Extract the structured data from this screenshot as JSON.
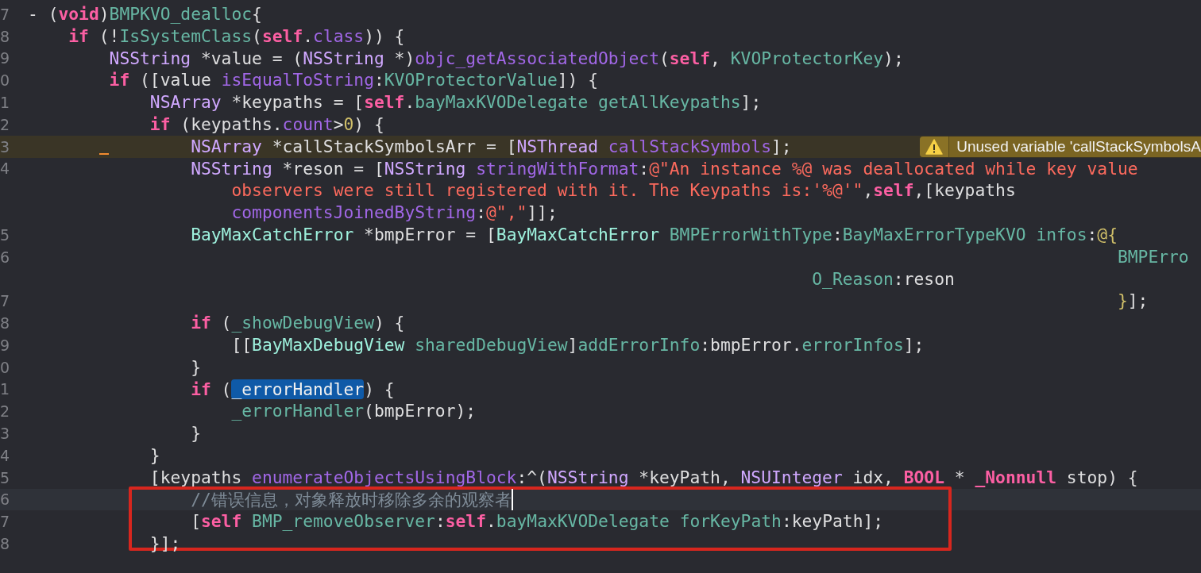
{
  "editor": {
    "lines": [
      {
        "number": "7",
        "tokens": [
          {
            "kind": "pl",
            "text": "- ("
          },
          {
            "kind": "kw",
            "text": "void"
          },
          {
            "kind": "pl",
            "text": ")"
          },
          {
            "kind": "pm",
            "text": "BMPKVO_dealloc"
          },
          {
            "kind": "pl",
            "text": "{"
          }
        ]
      },
      {
        "number": "8",
        "tokens": [
          {
            "kind": "kw",
            "text": "    if"
          },
          {
            "kind": "pl",
            "text": " (!"
          },
          {
            "kind": "pm",
            "text": "IsSystemClass"
          },
          {
            "kind": "pl",
            "text": "("
          },
          {
            "kind": "kw",
            "text": "self"
          },
          {
            "kind": "pl",
            "text": "."
          },
          {
            "kind": "fn",
            "text": "class"
          },
          {
            "kind": "pl",
            "text": ")) {"
          }
        ]
      },
      {
        "number": "9",
        "tokens": [
          {
            "kind": "ty",
            "text": "        NSString"
          },
          {
            "kind": "pl",
            "text": " *value = ("
          },
          {
            "kind": "ty",
            "text": "NSString"
          },
          {
            "kind": "pl",
            "text": " *)"
          },
          {
            "kind": "fn",
            "text": "objc_getAssociatedObject"
          },
          {
            "kind": "pl",
            "text": "("
          },
          {
            "kind": "kw",
            "text": "self"
          },
          {
            "kind": "pl",
            "text": ", "
          },
          {
            "kind": "pm",
            "text": "KVOProtectorKey"
          },
          {
            "kind": "pl",
            "text": ");"
          }
        ]
      },
      {
        "number": "0",
        "tokens": [
          {
            "kind": "kw",
            "text": "        if"
          },
          {
            "kind": "pl",
            "text": " ([value "
          },
          {
            "kind": "fn",
            "text": "isEqualToString"
          },
          {
            "kind": "pl",
            "text": ":"
          },
          {
            "kind": "pm",
            "text": "KVOProtectorValue"
          },
          {
            "kind": "pl",
            "text": "]) {"
          }
        ]
      },
      {
        "number": "1",
        "tokens": [
          {
            "kind": "ty",
            "text": "            NSArray"
          },
          {
            "kind": "pl",
            "text": " *keypaths = ["
          },
          {
            "kind": "kw",
            "text": "self"
          },
          {
            "kind": "pl",
            "text": "."
          },
          {
            "kind": "pm",
            "text": "bayMaxKVODelegate"
          },
          {
            "kind": "pm",
            "text": " getAllKeypaths"
          },
          {
            "kind": "pl",
            "text": "];"
          }
        ]
      },
      {
        "number": "2",
        "tokens": [
          {
            "kind": "kw",
            "text": "            if"
          },
          {
            "kind": "pl",
            "text": " (keypaths."
          },
          {
            "kind": "fn",
            "text": "count"
          },
          {
            "kind": "pl",
            "text": ">"
          },
          {
            "kind": "nu",
            "text": "0"
          },
          {
            "kind": "pl",
            "text": ") {"
          }
        ]
      },
      {
        "number": "3",
        "warning": "Unused variable 'callStackSymbolsA",
        "tokens": [
          {
            "kind": "ty",
            "text": "                NSArray"
          },
          {
            "kind": "pl",
            "text": " *callStackSymbolsArr = ["
          },
          {
            "kind": "ty",
            "text": "NSThread"
          },
          {
            "kind": "fn",
            "text": " callStackSymbols"
          },
          {
            "kind": "pl",
            "text": "];"
          }
        ]
      },
      {
        "number": "4",
        "tokens": [
          {
            "kind": "ty",
            "text": "                NSString"
          },
          {
            "kind": "pl",
            "text": " *reson = ["
          },
          {
            "kind": "ty",
            "text": "NSString"
          },
          {
            "kind": "fn",
            "text": " stringWithFormat"
          },
          {
            "kind": "pl",
            "text": ":"
          },
          {
            "kind": "st",
            "text": "@\"An instance %@ was deallocated while key value"
          }
        ]
      },
      {
        "tokens": [
          {
            "kind": "st",
            "text": "                    observers were still registered with it. The Keypaths is:'%@'\""
          },
          {
            "kind": "pl",
            "text": ","
          },
          {
            "kind": "kw",
            "text": "self"
          },
          {
            "kind": "pl",
            "text": ",[keypaths"
          }
        ]
      },
      {
        "tokens": [
          {
            "kind": "fn",
            "text": "                    componentsJoinedByString"
          },
          {
            "kind": "pl",
            "text": ":"
          },
          {
            "kind": "st",
            "text": "@\",\""
          },
          {
            "kind": "pl",
            "text": "]];"
          }
        ]
      },
      {
        "number": "5",
        "tokens": [
          {
            "kind": "pt",
            "text": "                BayMaxCatchError"
          },
          {
            "kind": "pl",
            "text": " *bmpError = ["
          },
          {
            "kind": "pt",
            "text": "BayMaxCatchError"
          },
          {
            "kind": "pm",
            "text": " BMPErrorWithType"
          },
          {
            "kind": "pl",
            "text": ":"
          },
          {
            "kind": "pm",
            "text": "BayMaxErrorTypeKVO"
          },
          {
            "kind": "pm",
            "text": " infos"
          },
          {
            "kind": "pl",
            "text": ":"
          },
          {
            "kind": "nu",
            "text": "@{"
          }
        ]
      },
      {
        "number": "6",
        "tokens": [
          {
            "kind": "pm",
            "text": "                                                                                                           BMPErro"
          }
        ]
      },
      {
        "tokens": [
          {
            "kind": "pm",
            "text": "                                                                             O_Reason"
          },
          {
            "kind": "pl",
            "text": ":reson"
          }
        ]
      },
      {
        "number": "7",
        "tokens": [
          {
            "kind": "nu",
            "text": "                                                                                                           }"
          },
          {
            "kind": "pl",
            "text": "];"
          }
        ]
      },
      {
        "number": "8",
        "tokens": [
          {
            "kind": "kw",
            "text": "                if"
          },
          {
            "kind": "pl",
            "text": " ("
          },
          {
            "kind": "pm",
            "text": "_showDebugView"
          },
          {
            "kind": "pl",
            "text": ") {"
          }
        ]
      },
      {
        "number": "9",
        "tokens": [
          {
            "kind": "pl",
            "text": "                    [["
          },
          {
            "kind": "pt",
            "text": "BayMaxDebugView"
          },
          {
            "kind": "pm",
            "text": " sharedDebugView"
          },
          {
            "kind": "pl",
            "text": "]"
          },
          {
            "kind": "pm",
            "text": "addErrorInfo"
          },
          {
            "kind": "pl",
            "text": ":bmpError."
          },
          {
            "kind": "pm",
            "text": "errorInfos"
          },
          {
            "kind": "pl",
            "text": "];"
          }
        ]
      },
      {
        "number": "0",
        "tokens": [
          {
            "kind": "pl",
            "text": "                }"
          }
        ]
      },
      {
        "number": "1",
        "tokens": [
          {
            "kind": "kw",
            "text": "                if"
          },
          {
            "kind": "pl",
            "text": " ("
          },
          {
            "kind": "sel",
            "text": "_errorHandler"
          },
          {
            "kind": "pl",
            "text": ") {"
          }
        ]
      },
      {
        "number": "2",
        "tokens": [
          {
            "kind": "pm",
            "text": "                    _errorHandler"
          },
          {
            "kind": "pl",
            "text": "(bmpError);"
          }
        ]
      },
      {
        "number": "3",
        "tokens": [
          {
            "kind": "pl",
            "text": "                }"
          }
        ]
      },
      {
        "number": "4",
        "tokens": [
          {
            "kind": "pl",
            "text": "            }"
          }
        ]
      },
      {
        "number": "5",
        "tokens": [
          {
            "kind": "pl",
            "text": "            [keypaths "
          },
          {
            "kind": "fn",
            "text": "enumerateObjectsUsingBlock"
          },
          {
            "kind": "pl",
            "text": ":^("
          },
          {
            "kind": "ty",
            "text": "NSString"
          },
          {
            "kind": "pl",
            "text": " *keyPath, "
          },
          {
            "kind": "ty",
            "text": "NSUInteger"
          },
          {
            "kind": "pl",
            "text": " idx, "
          },
          {
            "kind": "kw",
            "text": "BOOL"
          },
          {
            "kind": "pl",
            "text": " * "
          },
          {
            "kind": "kw",
            "text": "_Nonnull"
          },
          {
            "kind": "pl",
            "text": " stop) {"
          }
        ]
      },
      {
        "number": "6",
        "current": true,
        "cursor": true,
        "boxed": true,
        "tokens": [
          {
            "kind": "cm",
            "text": "                //错误信息，对象释放时移除多余的观察者"
          }
        ]
      },
      {
        "number": "7",
        "boxed": true,
        "tokens": [
          {
            "kind": "pl",
            "text": "                ["
          },
          {
            "kind": "kw",
            "text": "self"
          },
          {
            "kind": "pm",
            "text": " BMP_removeObserver"
          },
          {
            "kind": "pl",
            "text": ":"
          },
          {
            "kind": "kw",
            "text": "self"
          },
          {
            "kind": "pl",
            "text": "."
          },
          {
            "kind": "pm",
            "text": "bayMaxKVODelegate"
          },
          {
            "kind": "pm",
            "text": " forKeyPath"
          },
          {
            "kind": "pl",
            "text": ":keyPath];"
          }
        ]
      },
      {
        "number": "8",
        "tokens": [
          {
            "kind": "pl",
            "text": "            }];"
          }
        ]
      }
    ]
  }
}
